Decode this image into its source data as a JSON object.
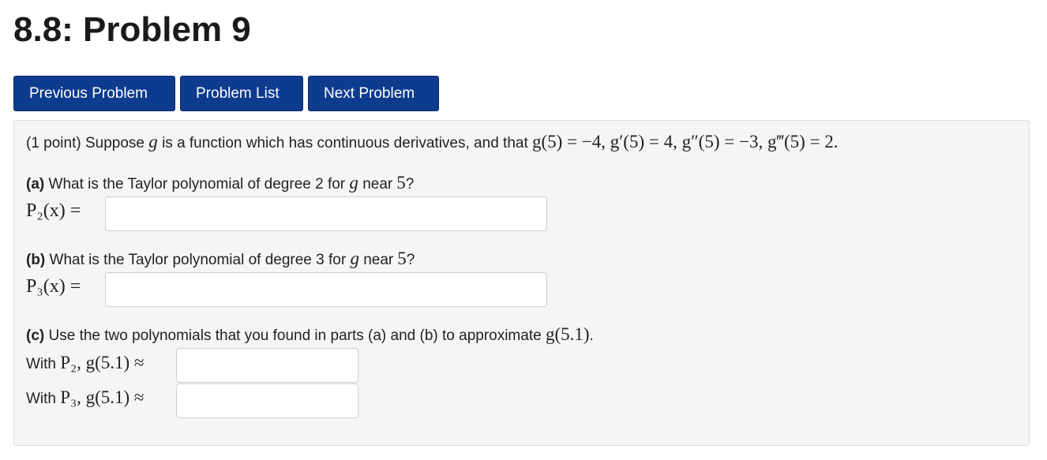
{
  "page": {
    "title": "8.8: Problem 9"
  },
  "nav": {
    "previous": "Previous Problem",
    "list": "Problem List",
    "next": "Next Problem"
  },
  "problem": {
    "points": "(1 point)",
    "intro_text": "Suppose",
    "g": "g",
    "intro_mid": "is a function which has continuous derivatives, and that",
    "intro_math": "g(5) = −4, g′(5) = 4, g″(5) = −3, g‴(5) = 2.",
    "part_a": {
      "label": "(a)",
      "question_pre": "What is the Taylor polynomial of degree 2 for",
      "question_post": "near",
      "point": "5",
      "end": "?",
      "answer_label": "P₂(x) =",
      "answer_value": ""
    },
    "part_b": {
      "label": "(b)",
      "question_pre": "What is the Taylor polynomial of degree 3 for",
      "question_post": "near",
      "point": "5",
      "end": "?",
      "answer_label": "P₃(x) =",
      "answer_value": ""
    },
    "part_c": {
      "label": "(c)",
      "question": "Use the two polynomials that you found in parts (a) and (b) to approximate",
      "target": "g(5.1)",
      "end": ".",
      "with": "With",
      "row1_math": "P₂, g(5.1) ≈",
      "row1_value": "",
      "row2_math": "P₃, g(5.1) ≈",
      "row2_value": ""
    }
  }
}
